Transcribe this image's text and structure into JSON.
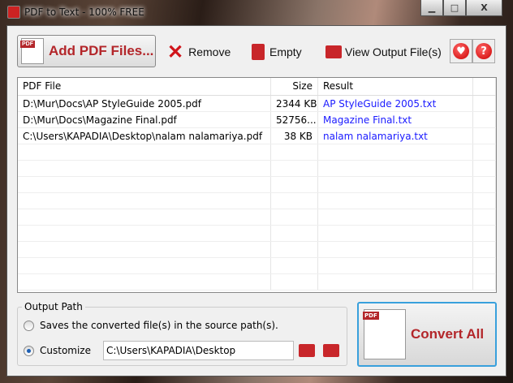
{
  "window": {
    "title": "PDF to Text - 100% FREE"
  },
  "toolbar": {
    "add": "Add PDF Files...",
    "remove": "Remove",
    "empty": "Empty",
    "view": "View Output File(s)"
  },
  "list": {
    "headers": [
      "PDF File",
      "Size",
      "Result"
    ],
    "rows": [
      {
        "file": "D:\\Mur\\Docs\\AP StyleGuide 2005.pdf",
        "size": "2344 KB",
        "result": "AP StyleGuide 2005.txt"
      },
      {
        "file": "D:\\Mur\\Docs\\Magazine Final.pdf",
        "size": "52756...",
        "result": "Magazine Final.txt"
      },
      {
        "file": "C:\\Users\\KAPADIA\\Desktop\\nalam nalamariya.pdf",
        "size": "38 KB",
        "result": "nalam nalamariya.txt"
      }
    ]
  },
  "output": {
    "group_label": "Output Path",
    "option_source": "Saves the converted file(s) in the source path(s).",
    "option_custom": "Customize",
    "path": "C:\\Users\\KAPADIA\\Desktop",
    "selected": "Customize"
  },
  "convert": {
    "label": "Convert All"
  }
}
